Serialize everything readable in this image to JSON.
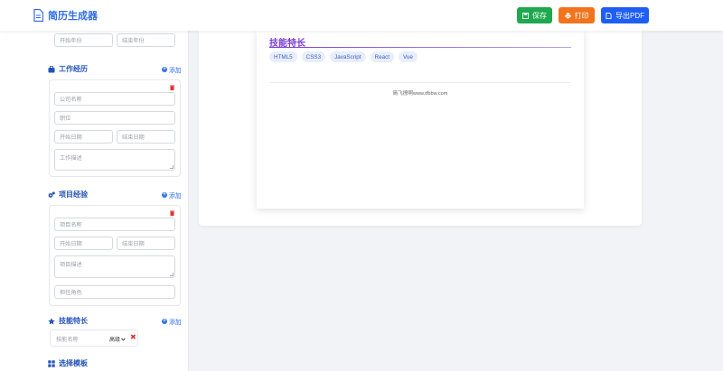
{
  "header": {
    "title": "简历生成器",
    "buttons": {
      "save": "保存",
      "print": "打印",
      "export_pdf": "导出PDF"
    },
    "colors": {
      "save": "#1fa84f",
      "print": "#f1731c",
      "export": "#1e5ef5",
      "brand": "#2f6de8"
    }
  },
  "sidebar": {
    "education_tail": {
      "start_year_placeholder": "开始年份",
      "end_year_placeholder": "结束年份"
    },
    "work": {
      "title": "工作经历",
      "add_label": "添加",
      "company_placeholder": "公司名称",
      "position_placeholder": "职位",
      "start_date_placeholder": "开始日期",
      "end_date_placeholder": "结束日期",
      "description_placeholder": "工作描述"
    },
    "project": {
      "title": "项目经验",
      "add_label": "添加",
      "name_placeholder": "项目名称",
      "start_date_placeholder": "开始日期",
      "end_date_placeholder": "结束日期",
      "description_placeholder": "项目描述",
      "role_placeholder": "担任角色"
    },
    "skills": {
      "title": "技能特长",
      "add_label": "添加",
      "name_placeholder": "技能名称",
      "level_value": "高级"
    },
    "template": {
      "title": "选择模板"
    }
  },
  "preview": {
    "skills_heading": "技能特长",
    "skill_tags": [
      "HTML5",
      "CSS3",
      "JavaScript",
      "React",
      "Vue"
    ],
    "footer": "简飞撩啊www.tfbbw.com"
  }
}
